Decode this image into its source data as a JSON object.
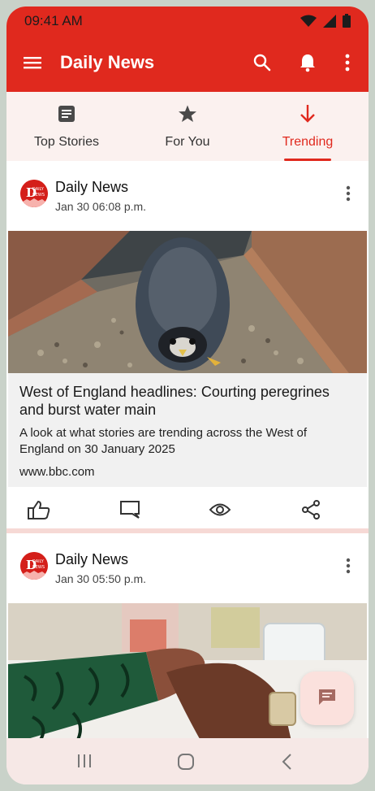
{
  "status_bar": {
    "time": "09:41 AM",
    "icons": [
      "wifi-icon",
      "signal-icon",
      "battery-icon"
    ]
  },
  "app_bar": {
    "title": "Daily News",
    "menu_icon": "hamburger-menu-icon",
    "actions": [
      "search-icon",
      "notification-bell-icon",
      "more-vert-icon"
    ],
    "color": "#e0291e"
  },
  "tabs": [
    {
      "label": "Top Stories",
      "icon": "article-icon",
      "active": false
    },
    {
      "label": "For You",
      "icon": "star-icon",
      "active": false
    },
    {
      "label": "Trending",
      "icon": "arrow-down-icon",
      "active": true
    }
  ],
  "feed": [
    {
      "source": "Daily News",
      "time": "Jan 30 06:08 p.m.",
      "headline": "West of England headlines: Courting peregrines and burst water main",
      "summary": "A look at what stories are trending across the West of England on 30 January 2025",
      "domain": "www.bbc.com",
      "image": "peregrine falcon in nest box",
      "actions": [
        "like-icon",
        "comment-icon",
        "views-icon",
        "share-icon"
      ]
    },
    {
      "source": "Daily News",
      "time": "Jan 30 05:50 p.m.",
      "image": "two people holding hands across a table"
    }
  ],
  "fab_icon": "message-icon",
  "nav_bar": [
    "recents-icon",
    "home-icon",
    "back-icon"
  ],
  "avatar_text": {
    "top": "DAILY",
    "bottom": "NEWS"
  }
}
